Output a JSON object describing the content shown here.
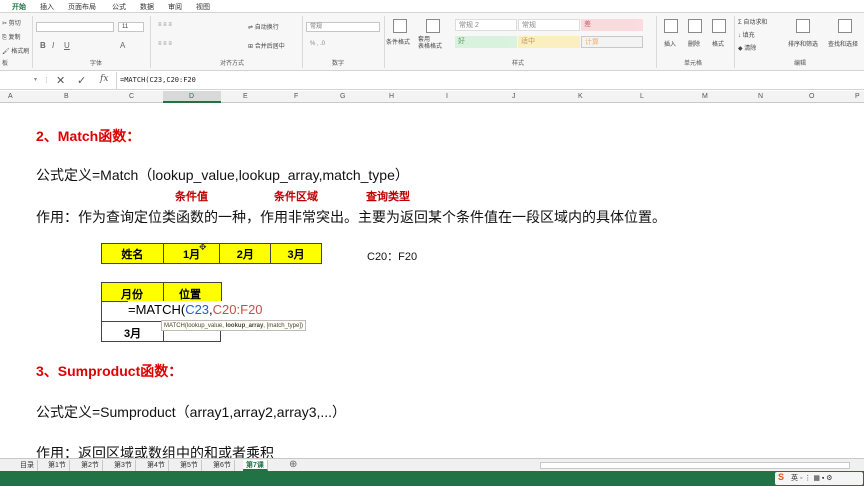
{
  "ribbon_tabs": [
    "开始",
    "插入",
    "页面布局",
    "公式",
    "数据",
    "审阅",
    "视图"
  ],
  "ribbon": {
    "clipboard": {
      "cut": "剪切",
      "copy": "复制",
      "format_painter": "格式刷",
      "label": "板"
    },
    "font": {
      "size": "11",
      "label": "字体"
    },
    "alignment": {
      "wrap": "自动换行",
      "merge": "合并后居中",
      "label": "对齐方式"
    },
    "number": {
      "format": "常规",
      "label": "数字"
    },
    "styles": {
      "conditional": "条件格式",
      "table_format": "套用\n表格格式",
      "cells": [
        "常规 2",
        "常规",
        "差",
        "好",
        "适中",
        "计算"
      ],
      "label": "样式"
    },
    "cells_group": {
      "insert": "插入",
      "delete": "删除",
      "format": "格式",
      "label": "单元格"
    },
    "editing": {
      "autosum": "自动求和",
      "fill": "填充",
      "clear": "清除",
      "sort": "排序和筛选",
      "find": "查找和选择",
      "label": "编辑"
    }
  },
  "formula_bar": {
    "formula": "=MATCH(C23,C20:F20"
  },
  "columns": [
    "A",
    "B",
    "C",
    "D",
    "E",
    "F",
    "G",
    "H",
    "I",
    "J",
    "K",
    "L",
    "M",
    "N",
    "O",
    "P"
  ],
  "content": {
    "heading2": "2、Match函数：",
    "def2": "公式定义=Match（lookup_value,lookup_array,match_type）",
    "ann_value": "条件值",
    "ann_range": "条件区域",
    "ann_type": "查询类型",
    "use2": "作用：作为查询定位类函数的一种，作用非常突出。主要为返回某个条件值在一段区域内的具体位置。",
    "range_label": "C20：F20",
    "table1": [
      "姓名",
      "1月",
      "2月",
      "3月"
    ],
    "table2_header": [
      "月份",
      "位置"
    ],
    "table2_row2": "3月",
    "cell_formula_prefix": "=MATCH(",
    "cell_formula_ref1": "C23",
    "cell_formula_comma": ",",
    "cell_formula_ref2": "C20:F20",
    "tooltip_pre": "MATCH(lookup_value, ",
    "tooltip_bold": "lookup_array",
    "tooltip_post": ", [match_type])",
    "heading3": "3、Sumproduct函数：",
    "def3": "公式定义=Sumproduct（array1,array2,array3,...）",
    "use3": "作用：返回区域或数组中的和或者乘积"
  },
  "sheet_tabs": [
    "目录",
    "第1节",
    "第2节",
    "第3节",
    "第4节",
    "第5节",
    "第6节",
    "第7课"
  ],
  "active_sheet": "第7课",
  "colors": {
    "excel_green": "#217346",
    "yellow": "#ffff00",
    "red": "#e00000"
  }
}
